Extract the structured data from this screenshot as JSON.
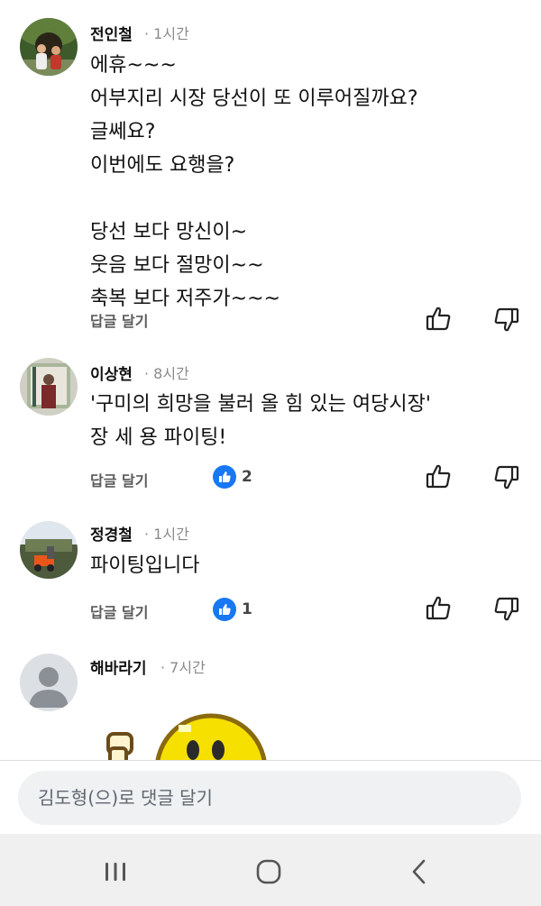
{
  "comments": [
    {
      "author": "전인철",
      "time": "· 1시간",
      "text": "에휴~~~\n어부지리 시장 당선이 또 이루어질까요?\n글쎄요?\n이번에도 요행을?\n\n당선 보다 망신이~\n웃음 보다 절망이~~\n축복 보다 저주가~~~",
      "reply": "답글 달기"
    },
    {
      "author": "이상현",
      "time": "· 8시간",
      "text": "'구미의 희망을 불러 올 힘 있는 여당시장'\n장 세 용 파이팅!",
      "reply": "답글 달기",
      "like_count": "2"
    },
    {
      "author": "정경철",
      "time": "· 1시간",
      "text": "파이팅입니다",
      "reply": "답글 달기",
      "like_count": "1"
    },
    {
      "author": "해바라기",
      "time": "· 7시간"
    }
  ],
  "composer": {
    "placeholder": "김도형(으)로 댓글 달기"
  },
  "colors": {
    "like_blue": "#1877f2",
    "text": "#111111",
    "muted": "#8a8a8a",
    "composer_bg": "#eff1f3",
    "navbar_bg": "#f0f0f1"
  },
  "icons": [
    "thumbs-up-icon",
    "thumbs-down-icon",
    "like-reaction-icon",
    "default-avatar-icon",
    "nav-recents-icon",
    "nav-home-icon",
    "nav-back-icon"
  ]
}
